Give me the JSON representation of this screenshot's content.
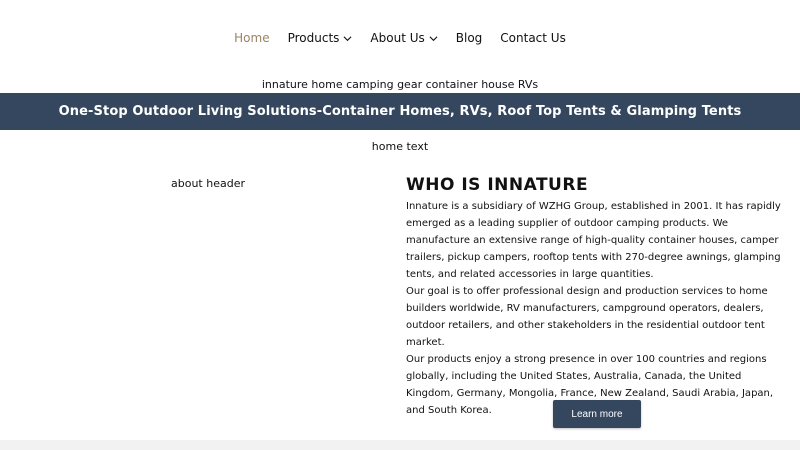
{
  "nav": {
    "items": [
      {
        "label": "Home",
        "active": true,
        "dropdown": false
      },
      {
        "label": "Products",
        "active": false,
        "dropdown": true
      },
      {
        "label": "About Us",
        "active": false,
        "dropdown": true
      },
      {
        "label": "Blog",
        "active": false,
        "dropdown": false
      },
      {
        "label": "Contact Us",
        "active": false,
        "dropdown": false
      }
    ],
    "active_color": "#9a8466"
  },
  "hero": {
    "image_alt": "innature home camping gear container house RVs"
  },
  "banner": {
    "title": "One-Stop Outdoor Living Solutions-Container Homes, RVs, Roof Top Tents & Glamping Tents",
    "background": "#34475e"
  },
  "home_text_alt": "home text",
  "about": {
    "image_alt": "about header",
    "title": "WHO IS INNATURE",
    "paragraphs": [
      "Innature is a subsidiary of WZHG Group, established in 2001. It has rapidly emerged as a leading supplier of outdoor camping products. We manufacture an extensive range of high-quality container houses, camper trailers, pickup campers, rooftop tents with 270-degree awnings, glamping tents, and related accessories in large quantities.",
      "Our goal is to offer professional design and production services to home builders worldwide, RV manufacturers, campground operators, dealers, outdoor retailers, and other stakeholders in the residential outdoor tent market.",
      "Our products enjoy a strong presence in over 100 countries and regions globally, including the United States, Australia, Canada, the United Kingdom, Germany, Mongolia, France, New Zealand, Saudi Arabia, Japan, and South Korea."
    ],
    "button_label": "Learn more"
  }
}
